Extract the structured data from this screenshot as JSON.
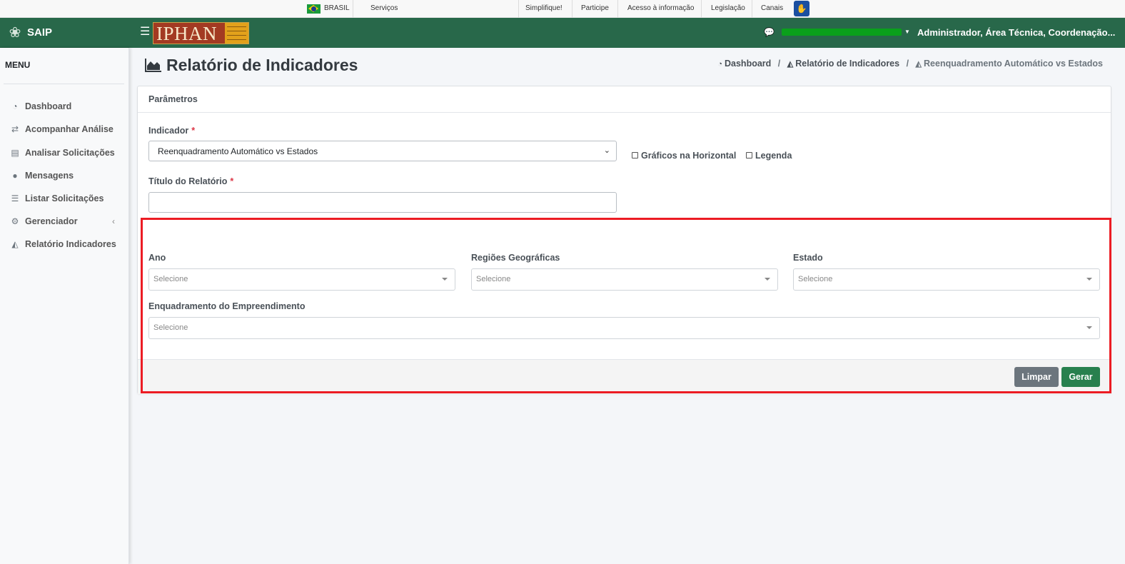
{
  "govbar": {
    "country": "BRASIL",
    "links": [
      "Serviços",
      "Simplifique!",
      "Participe",
      "Acesso à informação",
      "Legislação",
      "Canais"
    ]
  },
  "brand": {
    "name": "SAIP"
  },
  "header": {
    "logo_text": "IPHAN",
    "user_role": "Administrador, Área Técnica, Coordenação..."
  },
  "sidebar": {
    "title": "MENU",
    "items": [
      {
        "label": "Dashboard",
        "icon": "dashboard-icon"
      },
      {
        "label": "Acompanhar Análise",
        "icon": "exchange-icon"
      },
      {
        "label": "Analisar Solicitações",
        "icon": "book-icon"
      },
      {
        "label": "Mensagens",
        "icon": "comments-icon"
      },
      {
        "label": "Listar Solicitações",
        "icon": "list-icon"
      },
      {
        "label": "Gerenciador",
        "icon": "cogs-icon"
      },
      {
        "label": "Relatório Indicadores",
        "icon": "area-chart-icon"
      }
    ]
  },
  "page": {
    "title": "Relatório de Indicadores",
    "breadcrumb": [
      "Dashboard",
      "Relatório de Indicadores",
      "Reenquadramento Automático vs Estados"
    ]
  },
  "card": {
    "header": "Parâmetros",
    "indicador_label": "Indicador",
    "indicador_value": "Reenquadramento Automático vs Estados",
    "checkbox_horizontal": "Gráficos na Horizontal",
    "checkbox_legenda": "Legenda",
    "titulo_label": "Título do Relatório",
    "titulo_value": "",
    "required_mark": "*",
    "ano_label": "Ano",
    "regioes_label": "Regiões Geográficas",
    "estado_label": "Estado",
    "enquadramento_label": "Enquadramento do Empreendimento",
    "select_placeholder": "Selecione",
    "btn_limpar": "Limpar",
    "btn_gerar": "Gerar"
  },
  "colors": {
    "header_green": "#28684a",
    "highlight_red": "#ec1c24",
    "gerar_green": "#28804e",
    "limpar_gray": "#6c757d"
  }
}
